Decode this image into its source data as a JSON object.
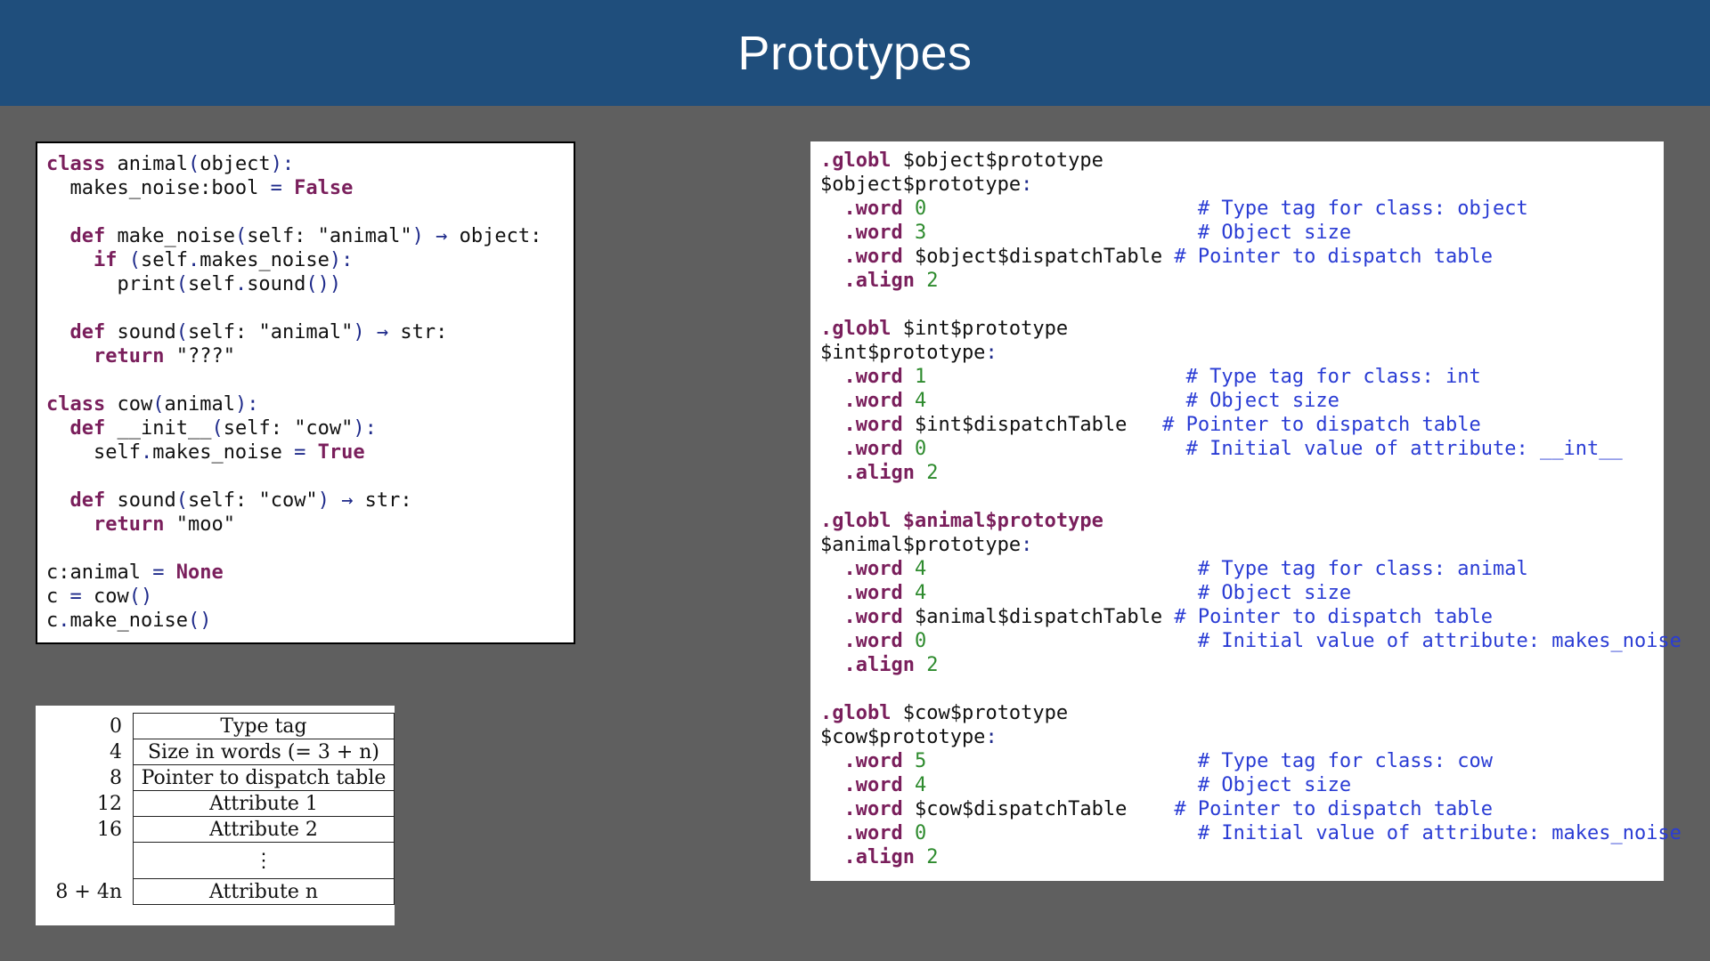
{
  "title": "Prototypes",
  "python_code": [
    [
      [
        "kw",
        "class"
      ],
      [
        "t",
        " animal"
      ],
      [
        "pn",
        "("
      ],
      [
        "t",
        "object"
      ],
      [
        "pn",
        "):"
      ]
    ],
    [
      [
        "t",
        "  makes_noise:bool "
      ],
      [
        "pn",
        "="
      ],
      [
        "t",
        " "
      ],
      [
        "kw",
        "False"
      ]
    ],
    [],
    [
      [
        "t",
        "  "
      ],
      [
        "kw",
        "def"
      ],
      [
        "t",
        " make_noise"
      ],
      [
        "pn",
        "("
      ],
      [
        "t",
        "self: \"animal\""
      ],
      [
        "pn",
        ")"
      ],
      [
        "t",
        " "
      ],
      [
        "pn",
        "→"
      ],
      [
        "t",
        " object:"
      ]
    ],
    [
      [
        "t",
        "    "
      ],
      [
        "kw",
        "if"
      ],
      [
        "t",
        " "
      ],
      [
        "pn",
        "("
      ],
      [
        "t",
        "self"
      ],
      [
        "pn",
        "."
      ],
      [
        "t",
        "makes_noise"
      ],
      [
        "pn",
        "):"
      ]
    ],
    [
      [
        "t",
        "      print"
      ],
      [
        "pn",
        "("
      ],
      [
        "t",
        "self"
      ],
      [
        "pn",
        "."
      ],
      [
        "t",
        "sound"
      ],
      [
        "pn",
        "())"
      ]
    ],
    [],
    [
      [
        "t",
        "  "
      ],
      [
        "kw",
        "def"
      ],
      [
        "t",
        " sound"
      ],
      [
        "pn",
        "("
      ],
      [
        "t",
        "self: \"animal\""
      ],
      [
        "pn",
        ")"
      ],
      [
        "t",
        " "
      ],
      [
        "pn",
        "→"
      ],
      [
        "t",
        " str:"
      ]
    ],
    [
      [
        "t",
        "    "
      ],
      [
        "kw",
        "return"
      ],
      [
        "t",
        " \"???\""
      ]
    ],
    [],
    [
      [
        "kw",
        "class"
      ],
      [
        "t",
        " cow"
      ],
      [
        "pn",
        "("
      ],
      [
        "t",
        "animal"
      ],
      [
        "pn",
        "):"
      ]
    ],
    [
      [
        "t",
        "  "
      ],
      [
        "kw",
        "def"
      ],
      [
        "t",
        " __init__"
      ],
      [
        "pn",
        "("
      ],
      [
        "t",
        "self: \"cow\""
      ],
      [
        "pn",
        "):"
      ]
    ],
    [
      [
        "t",
        "    self"
      ],
      [
        "pn",
        "."
      ],
      [
        "t",
        "makes_noise "
      ],
      [
        "pn",
        "="
      ],
      [
        "t",
        " "
      ],
      [
        "kw",
        "True"
      ]
    ],
    [],
    [
      [
        "t",
        "  "
      ],
      [
        "kw",
        "def"
      ],
      [
        "t",
        " sound"
      ],
      [
        "pn",
        "("
      ],
      [
        "t",
        "self: \"cow\""
      ],
      [
        "pn",
        ")"
      ],
      [
        "t",
        " "
      ],
      [
        "pn",
        "→"
      ],
      [
        "t",
        " str:"
      ]
    ],
    [
      [
        "t",
        "    "
      ],
      [
        "kw",
        "return"
      ],
      [
        "t",
        " \"moo\""
      ]
    ],
    [],
    [
      [
        "t",
        "c:animal "
      ],
      [
        "pn",
        "="
      ],
      [
        "t",
        " "
      ],
      [
        "kw",
        "None"
      ]
    ],
    [
      [
        "t",
        "c "
      ],
      [
        "pn",
        "="
      ],
      [
        "t",
        " cow"
      ],
      [
        "pn",
        "()"
      ]
    ],
    [
      [
        "t",
        "c"
      ],
      [
        "pn",
        "."
      ],
      [
        "t",
        "make_noise"
      ],
      [
        "pn",
        "()"
      ]
    ]
  ],
  "assembly_code": [
    [
      [
        "dir",
        ".globl"
      ],
      [
        "t",
        " $object$prototype"
      ]
    ],
    [
      [
        "t",
        "$object$prototype"
      ],
      [
        "pn",
        ":"
      ]
    ],
    [
      [
        "t",
        "  "
      ],
      [
        "dir",
        ".word"
      ],
      [
        "t",
        " "
      ],
      [
        "num",
        "0"
      ],
      [
        "t",
        "                       "
      ],
      [
        "cmt",
        "# Type tag for class: object"
      ]
    ],
    [
      [
        "t",
        "  "
      ],
      [
        "dir",
        ".word"
      ],
      [
        "t",
        " "
      ],
      [
        "num",
        "3"
      ],
      [
        "t",
        "                       "
      ],
      [
        "cmt",
        "# Object size"
      ]
    ],
    [
      [
        "t",
        "  "
      ],
      [
        "dir",
        ".word"
      ],
      [
        "t",
        " $object$dispatchTable "
      ],
      [
        "cmt",
        "# Pointer to dispatch table"
      ]
    ],
    [
      [
        "t",
        "  "
      ],
      [
        "dir",
        ".align"
      ],
      [
        "t",
        " "
      ],
      [
        "num",
        "2"
      ]
    ],
    [],
    [
      [
        "dir",
        ".globl"
      ],
      [
        "t",
        " $int$prototype"
      ]
    ],
    [
      [
        "t",
        "$int$prototype"
      ],
      [
        "pn",
        ":"
      ]
    ],
    [
      [
        "t",
        "  "
      ],
      [
        "dir",
        ".word"
      ],
      [
        "t",
        " "
      ],
      [
        "num",
        "1"
      ],
      [
        "t",
        "                      "
      ],
      [
        "cmt",
        "# Type tag for class: int"
      ]
    ],
    [
      [
        "t",
        "  "
      ],
      [
        "dir",
        ".word"
      ],
      [
        "t",
        " "
      ],
      [
        "num",
        "4"
      ],
      [
        "t",
        "                      "
      ],
      [
        "cmt",
        "# Object size"
      ]
    ],
    [
      [
        "t",
        "  "
      ],
      [
        "dir",
        ".word"
      ],
      [
        "t",
        " $int$dispatchTable   "
      ],
      [
        "cmt",
        "# Pointer to dispatch table"
      ]
    ],
    [
      [
        "t",
        "  "
      ],
      [
        "dir",
        ".word"
      ],
      [
        "t",
        " "
      ],
      [
        "num",
        "0"
      ],
      [
        "t",
        "                      "
      ],
      [
        "cmt",
        "# Initial value of attribute: __int__"
      ]
    ],
    [
      [
        "t",
        "  "
      ],
      [
        "dir",
        ".align"
      ],
      [
        "t",
        " "
      ],
      [
        "num",
        "2"
      ]
    ],
    [],
    [
      [
        "dir",
        ".globl $animal$prototype"
      ]
    ],
    [
      [
        "t",
        "$animal$prototype"
      ],
      [
        "pn",
        ":"
      ]
    ],
    [
      [
        "t",
        "  "
      ],
      [
        "dir",
        ".word"
      ],
      [
        "t",
        " "
      ],
      [
        "num",
        "4"
      ],
      [
        "t",
        "                       "
      ],
      [
        "cmt",
        "# Type tag for class: animal"
      ]
    ],
    [
      [
        "t",
        "  "
      ],
      [
        "dir",
        ".word"
      ],
      [
        "t",
        " "
      ],
      [
        "num",
        "4"
      ],
      [
        "t",
        "                       "
      ],
      [
        "cmt",
        "# Object size"
      ]
    ],
    [
      [
        "t",
        "  "
      ],
      [
        "dir",
        ".word"
      ],
      [
        "t",
        " $animal$dispatchTable "
      ],
      [
        "cmt",
        "# Pointer to dispatch table"
      ]
    ],
    [
      [
        "t",
        "  "
      ],
      [
        "dir",
        ".word"
      ],
      [
        "t",
        " "
      ],
      [
        "num",
        "0"
      ],
      [
        "t",
        "                       "
      ],
      [
        "cmt",
        "# Initial value of attribute: makes_noise"
      ]
    ],
    [
      [
        "t",
        "  "
      ],
      [
        "dir",
        ".align"
      ],
      [
        "t",
        " "
      ],
      [
        "num",
        "2"
      ]
    ],
    [],
    [
      [
        "dir",
        ".globl"
      ],
      [
        "t",
        " $cow$prototype"
      ]
    ],
    [
      [
        "t",
        "$cow$prototype"
      ],
      [
        "pn",
        ":"
      ]
    ],
    [
      [
        "t",
        "  "
      ],
      [
        "dir",
        ".word"
      ],
      [
        "t",
        " "
      ],
      [
        "num",
        "5"
      ],
      [
        "t",
        "                       "
      ],
      [
        "cmt",
        "# Type tag for class: cow"
      ]
    ],
    [
      [
        "t",
        "  "
      ],
      [
        "dir",
        ".word"
      ],
      [
        "t",
        " "
      ],
      [
        "num",
        "4"
      ],
      [
        "t",
        "                       "
      ],
      [
        "cmt",
        "# Object size"
      ]
    ],
    [
      [
        "t",
        "  "
      ],
      [
        "dir",
        ".word"
      ],
      [
        "t",
        " $cow$dispatchTable    "
      ],
      [
        "cmt",
        "# Pointer to dispatch table"
      ]
    ],
    [
      [
        "t",
        "  "
      ],
      [
        "dir",
        ".word"
      ],
      [
        "t",
        " "
      ],
      [
        "num",
        "0"
      ],
      [
        "t",
        "                       "
      ],
      [
        "cmt",
        "# Initial value of attribute: makes_noise"
      ]
    ],
    [
      [
        "t",
        "  "
      ],
      [
        "dir",
        ".align"
      ],
      [
        "t",
        " "
      ],
      [
        "num",
        "2"
      ]
    ]
  ],
  "object_layout": {
    "rows": [
      {
        "offset": "0",
        "field": "Type tag"
      },
      {
        "offset": "4",
        "field": "Size in words (= 3 + n)"
      },
      {
        "offset": "8",
        "field": "Pointer to dispatch table"
      },
      {
        "offset": "12",
        "field": "Attribute 1"
      },
      {
        "offset": "16",
        "field": "Attribute 2"
      },
      {
        "offset": "",
        "field": "⋮"
      },
      {
        "offset": "8 + 4n",
        "field": "Attribute n"
      }
    ]
  }
}
